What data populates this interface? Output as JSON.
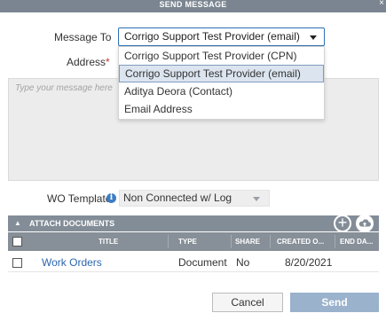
{
  "dialog": {
    "title": "SEND MESSAGE",
    "close_icon": "close-icon"
  },
  "message_to": {
    "label": "Message To",
    "value": "Corrigo Support Test Provider (email)",
    "options": [
      "Corrigo Support Test Provider (CPN)",
      "Corrigo Support Test Provider (email)",
      "Aditya Deora (Contact)",
      "Email Address"
    ],
    "selected_index": 1
  },
  "address": {
    "label": "Address",
    "required_mark": "*",
    "value": ""
  },
  "message": {
    "placeholder": "Type your message here"
  },
  "wo_template": {
    "label": "WO Template",
    "info_icon": "info-icon",
    "value": "Non Connected w/ Log"
  },
  "attach_documents": {
    "label": "ATTACH DOCUMENTS",
    "add_icon": "plus-circle-icon",
    "upload_icon": "cloud-upload-icon",
    "columns": [
      "TITLE",
      "TYPE",
      "SHARE",
      "CREATED O...",
      "END DA..."
    ],
    "rows": [
      {
        "title": "Work Orders",
        "type": "Document",
        "share": "No",
        "created": "8/20/2021",
        "end": ""
      }
    ]
  },
  "footer": {
    "cancel_label": "Cancel",
    "send_label": "Send"
  },
  "colors": {
    "header_gray": "#838d98",
    "link_blue": "#2d67ad",
    "send_blue": "#9ab2cc",
    "required_red": "#c0392b"
  }
}
